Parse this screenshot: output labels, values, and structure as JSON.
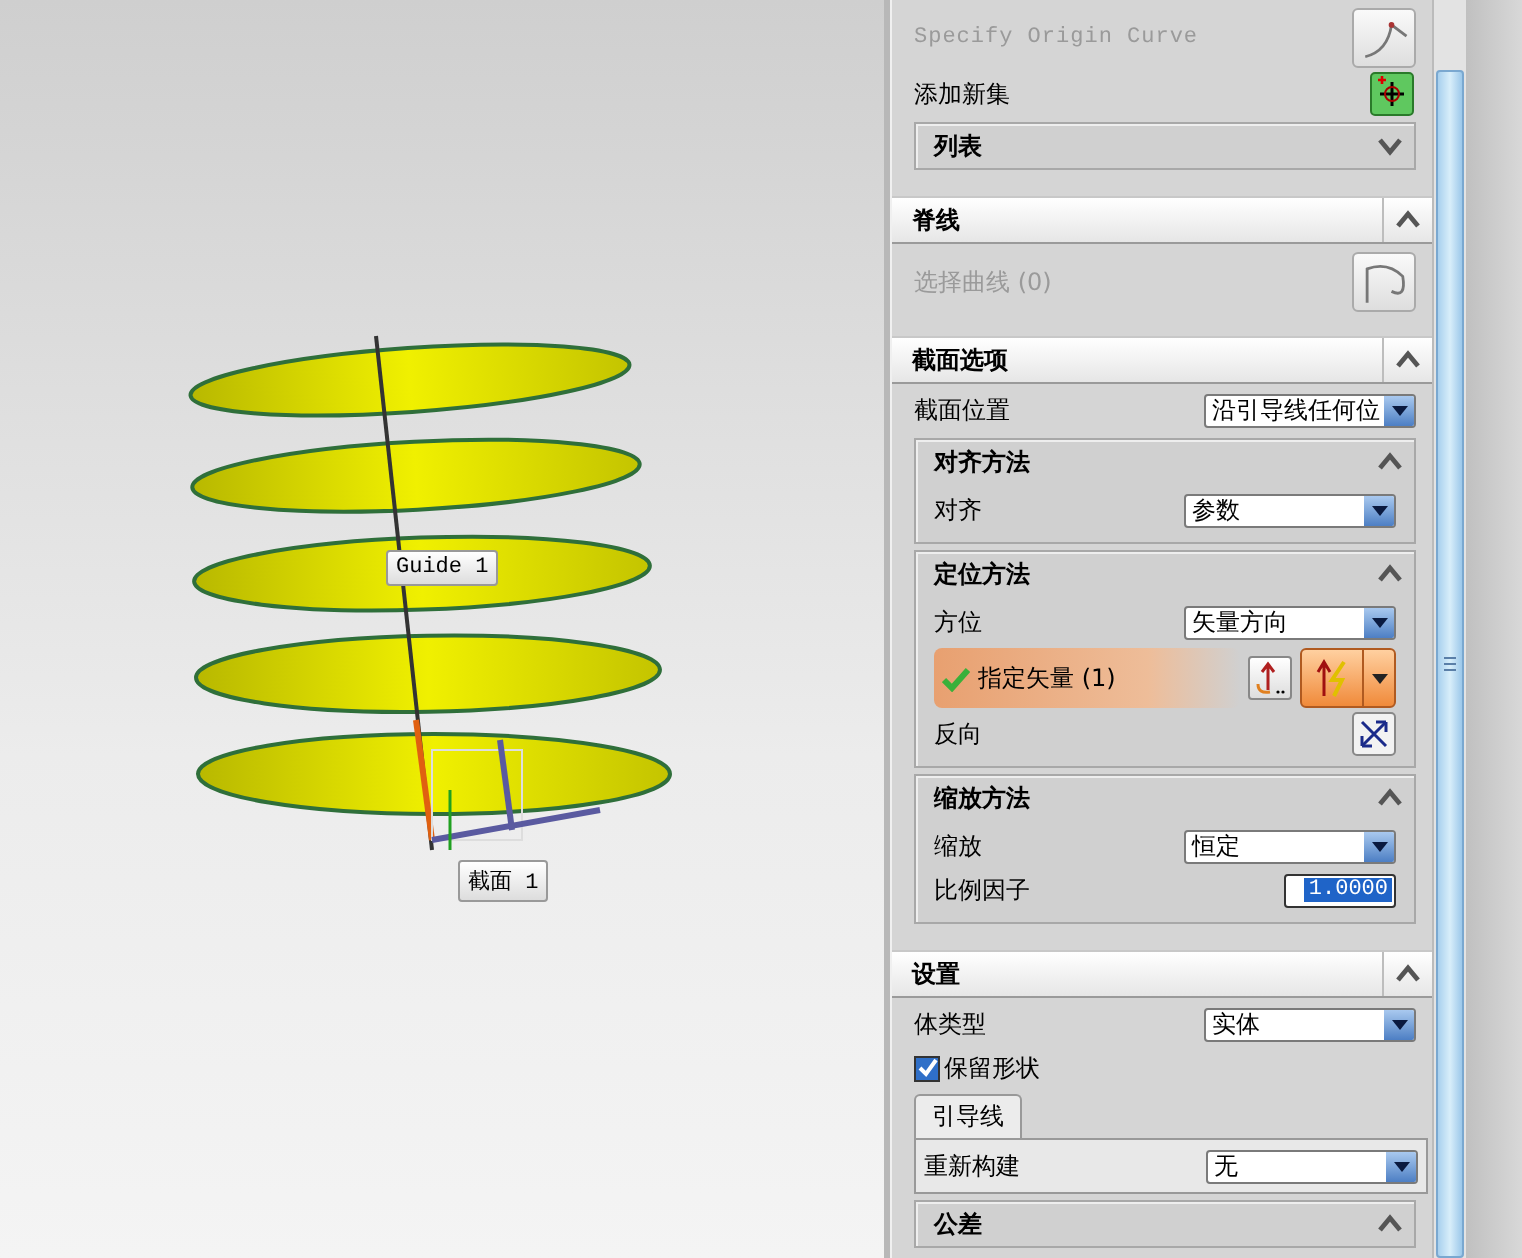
{
  "viewport": {
    "labels": [
      {
        "text": "Guide 1",
        "kind": "guide"
      },
      {
        "text": "截面 1",
        "kind": "section"
      }
    ]
  },
  "panel": {
    "sections": [
      {
        "items": [
          {
            "kind": "origin",
            "label": "Specify Origin Curve",
            "disabled": true
          },
          {
            "kind": "addset",
            "label": "添加新集"
          },
          {
            "kind": "group",
            "title": "列表",
            "expanded": false
          }
        ]
      },
      {
        "title": "脊线",
        "expanded": true,
        "items": [
          {
            "kind": "spine",
            "label": "选择曲线 (0)",
            "disabled": true
          }
        ]
      },
      {
        "title": "截面选项",
        "expanded": true,
        "items": [
          {
            "kind": "dropdown",
            "label": "截面位置",
            "value": "沿引导线任何位"
          },
          {
            "kind": "group",
            "title": "对齐方法",
            "expanded": true,
            "items": [
              {
                "kind": "dropdown",
                "label": "对齐",
                "value": "参数"
              }
            ]
          },
          {
            "kind": "group",
            "title": "定位方法",
            "expanded": true,
            "items": [
              {
                "kind": "dropdown",
                "label": "方位",
                "value": "矢量方向"
              },
              {
                "kind": "vector",
                "label": "指定矢量 (1)",
                "selected": true,
                "done": true
              },
              {
                "kind": "reverse",
                "label": "反向"
              }
            ]
          },
          {
            "kind": "group",
            "title": "缩放方法",
            "expanded": true,
            "items": [
              {
                "kind": "dropdown",
                "label": "缩放",
                "value": "恒定"
              },
              {
                "kind": "field",
                "label": "比例因子",
                "value": "1.0000",
                "selected": true
              }
            ]
          }
        ]
      },
      {
        "title": "设置",
        "expanded": true,
        "items": [
          {
            "kind": "dropdown",
            "label": "体类型",
            "value": "实体"
          },
          {
            "kind": "checkbox",
            "label": "保留形状",
            "checked": true
          },
          {
            "kind": "tabs",
            "tabs": [
              {
                "label": "引导线",
                "selected": true
              }
            ],
            "items": [
              {
                "kind": "dropdown",
                "label": "重新构建",
                "value": "无"
              }
            ]
          },
          {
            "kind": "group",
            "title": "公差",
            "expanded": true
          }
        ]
      }
    ]
  }
}
